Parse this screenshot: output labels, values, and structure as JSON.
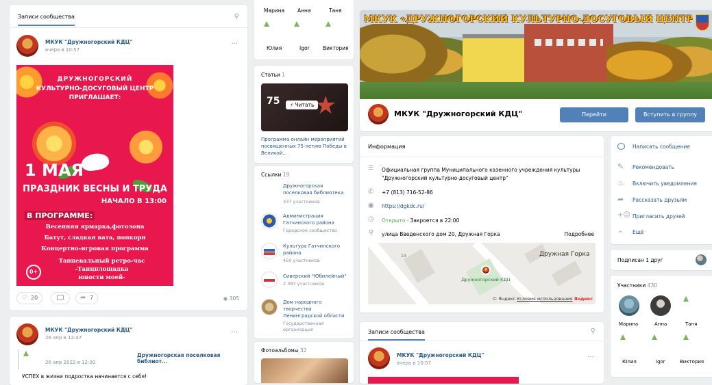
{
  "left": {
    "header": "Записи сообщества",
    "post1": {
      "author": "МКУК \"Дружногорский КДЦ\"",
      "time": "вчера в 10:57",
      "poster": {
        "line1": "ДРУЖНОГОРСКИЙ",
        "line2": "КУЛЬТУРНО-ДОСУГОВЫЙ ЦЕНТР",
        "line3": "ПРИГЛАШАЕТ:",
        "date": "1 МАЯ",
        "holiday": "ПРАЗДНИК ВЕСНЫ И ТРУДА",
        "start": "НАЧАЛО В 13:00",
        "program": "В ПРОГРАММЕ:",
        "p1": "Весенняя ярмарка,фотозона",
        "p2": "Батут, сладкая вата, попкорн",
        "p3": "Концертно-игровая программа",
        "p4": "Танцевальный ретро-час",
        "p5": "-Танцплощадка",
        "p6": "юности моей-",
        "age": "0+"
      },
      "likes": "20",
      "shares": "7",
      "views": "305"
    },
    "post2": {
      "author": "МКУК \"Дружногорский КДЦ\"",
      "time": "26 апр в 12:47",
      "repost_date": "26 апр 2022 в 12:00",
      "repost_source": "Дружногорская поселковая библиот...",
      "text": "УСПЕХ в жизни подростка начинается с себя!"
    }
  },
  "middle": {
    "friends_top": [
      "Марина",
      "Анна",
      "Таня"
    ],
    "friends_bottom": [
      "Юлия",
      "Igor",
      "Виктория"
    ],
    "articles": {
      "title": "Статьи",
      "count": "1",
      "read_label": "Читать",
      "caption": "Программа онлайн мероприятий посвященных 75-летию Победы в Великой..."
    },
    "links": {
      "title": "Ссылки",
      "count": "19",
      "items": [
        {
          "name": "Дружногорская поселковая библиотека",
          "sub": "337 участников"
        },
        {
          "name": "Администрация Гатчинского района",
          "sub": "Городское сообщество"
        },
        {
          "name": "Культура Гатчинского района",
          "sub": "450 участников"
        },
        {
          "name": "Сиверский \"Юбилейный\"",
          "sub": "2 387 участников"
        },
        {
          "name": "Дом народного творчества Ленинградской области",
          "sub": "Государственная организация"
        }
      ]
    },
    "albums": {
      "title": "Фотоальбомы",
      "count": "32"
    }
  },
  "main": {
    "cover_text": "МКУК «ДРУЖНОГОРСКИЙ КУЛЬТУРНО-ДОСУГОВЫЙ ЦЕНТР»",
    "group_name": "МКУК \"Дружногорский КДЦ\"",
    "go_button": "Перейти",
    "join_button": "Вступить в группу",
    "info": {
      "title": "Информация",
      "description": "Официальная группа Муниципального казенного учреждения культуры \"Дружногорский культурно-досуговый центр\"",
      "phone": "+7 (813) 716-52-86",
      "site": "https://dgkdc.ru/",
      "open": "Открыто",
      "closes": " · Закроется в 22:00",
      "address": "улица Введенского дом 20, Дружная Горка",
      "more": "Подробнее"
    },
    "map": {
      "place": "Дружная Горка",
      "pin_label": "Дружногорский КДЦ",
      "house": "19",
      "copyright": "© Яндекс",
      "terms": "Условия использования",
      "brand": "Яндекс"
    },
    "posts": {
      "header": "Записи сообщества",
      "author": "МКУК \"Дружногорский КДЦ\"",
      "time": "вчера в 10:57"
    }
  },
  "right": {
    "actions": [
      "Написать сообщение",
      "Рекомендовать",
      "Включить уведомления",
      "Рассказать друзьям",
      "Пригласить друзей",
      "Ещё"
    ],
    "subscribed": "Подписан 1 друг",
    "members": {
      "title": "Участники",
      "count": "430",
      "top": [
        "Марина",
        "Анна",
        "Таня"
      ],
      "bottom": [
        "Юлия",
        "Igor",
        "Виктория"
      ]
    }
  }
}
